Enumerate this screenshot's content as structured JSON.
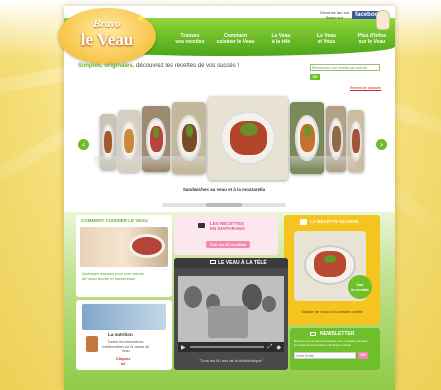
{
  "header": {
    "logo_line1": "Bravo",
    "logo_line2": "le Veau",
    "nav": [
      "Trouvez\nvos recettes",
      "Comment\ncuisiner le Veau",
      "Le Veau\nà la télé",
      "Le Veau\net Vous",
      "Plus d'infos\nsur le Veau"
    ],
    "social_text": "Devenez fan sur\nBravo sur",
    "facebook_label": "facebook"
  },
  "tagline": {
    "highlight1": "Simples",
    "sep": ", ",
    "highlight2": "originales",
    "rest": ", découvrez les recettes de vos succès !"
  },
  "search": {
    "placeholder": "Rechercher une recette par mot-clé",
    "button": "OK",
    "advanced": "Recherche avancée"
  },
  "carousel": {
    "caption": "Sandwiches au veau et à la mozzarella",
    "prev": "‹",
    "next": "›"
  },
  "colors": {
    "brand_green": "#6fbf2a",
    "brand_pink": "#f28bb0",
    "brand_yellow": "#f6c41f"
  },
  "cuisiner": {
    "title": "COMMENT CUISINER LE VEAU",
    "desc": "Quelques astuces pour une viande\nde Veau tendre et savoureuse"
  },
  "diaporama": {
    "title": "LES RECETTES\nEN DIAPORAMA",
    "button": "Voir les 40 recettes"
  },
  "recette_mois": {
    "title": "LA RECETTE DU MOIS",
    "badge": "Voir\nla recette",
    "caption": "Salade de veau à la tomate confite"
  },
  "video": {
    "title": "LE VEAU À LA TÉLÉ",
    "caption": "\"Tous les 60 ans de la bibiliothèque\""
  },
  "nutrition": {
    "title": "La nutrition",
    "desc": "Toutes les informations\nnutritionnelles sur la viande de\nVeau",
    "link": "Cliquez\nici"
  },
  "newsletter": {
    "title": "NEWSLETTER",
    "desc": "Recevez par email nos recettes, nos nouvelles recettes\net toutes les informations de Bravo le Veau",
    "placeholder": "Votre Email",
    "button": "OK"
  }
}
